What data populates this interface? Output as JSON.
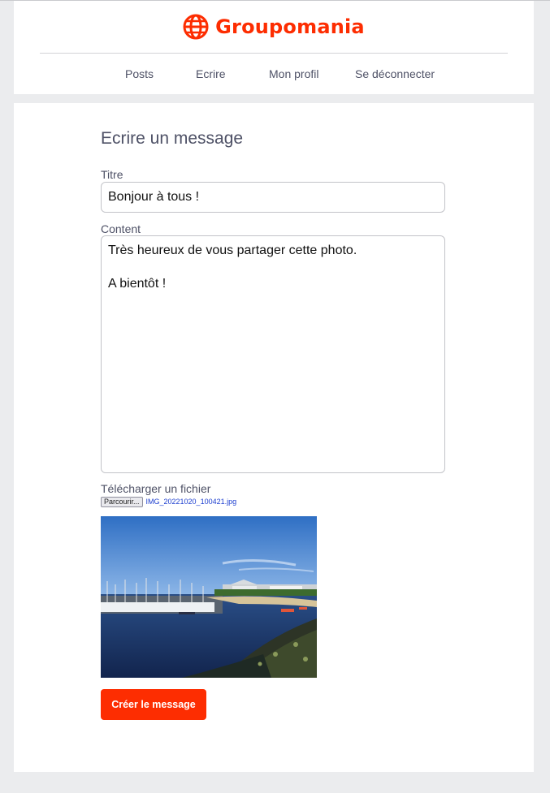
{
  "brand": {
    "name": "Groupomania",
    "accent": "#fd2d01",
    "icon": "globe-icon"
  },
  "nav": {
    "items": [
      {
        "label": "Posts"
      },
      {
        "label": "Ecrire"
      },
      {
        "label": "Mon profil"
      },
      {
        "label": "Se déconnecter"
      }
    ]
  },
  "form": {
    "heading": "Ecrire un message",
    "title_label": "Titre",
    "title_value": "Bonjour à tous !",
    "content_label": "Content",
    "content_value": "Très heureux de vous partager cette photo.\n\nA bientôt !",
    "file_label": "Télécharger un fichier",
    "browse_label": "Parcourir...",
    "file_name": "IMG_20221020_100421.jpg",
    "submit_label": "Créer le message"
  },
  "colors": {
    "background": "#ebecee",
    "panel": "#ffffff",
    "text": "#4e5166",
    "accent": "#fd2d01"
  }
}
